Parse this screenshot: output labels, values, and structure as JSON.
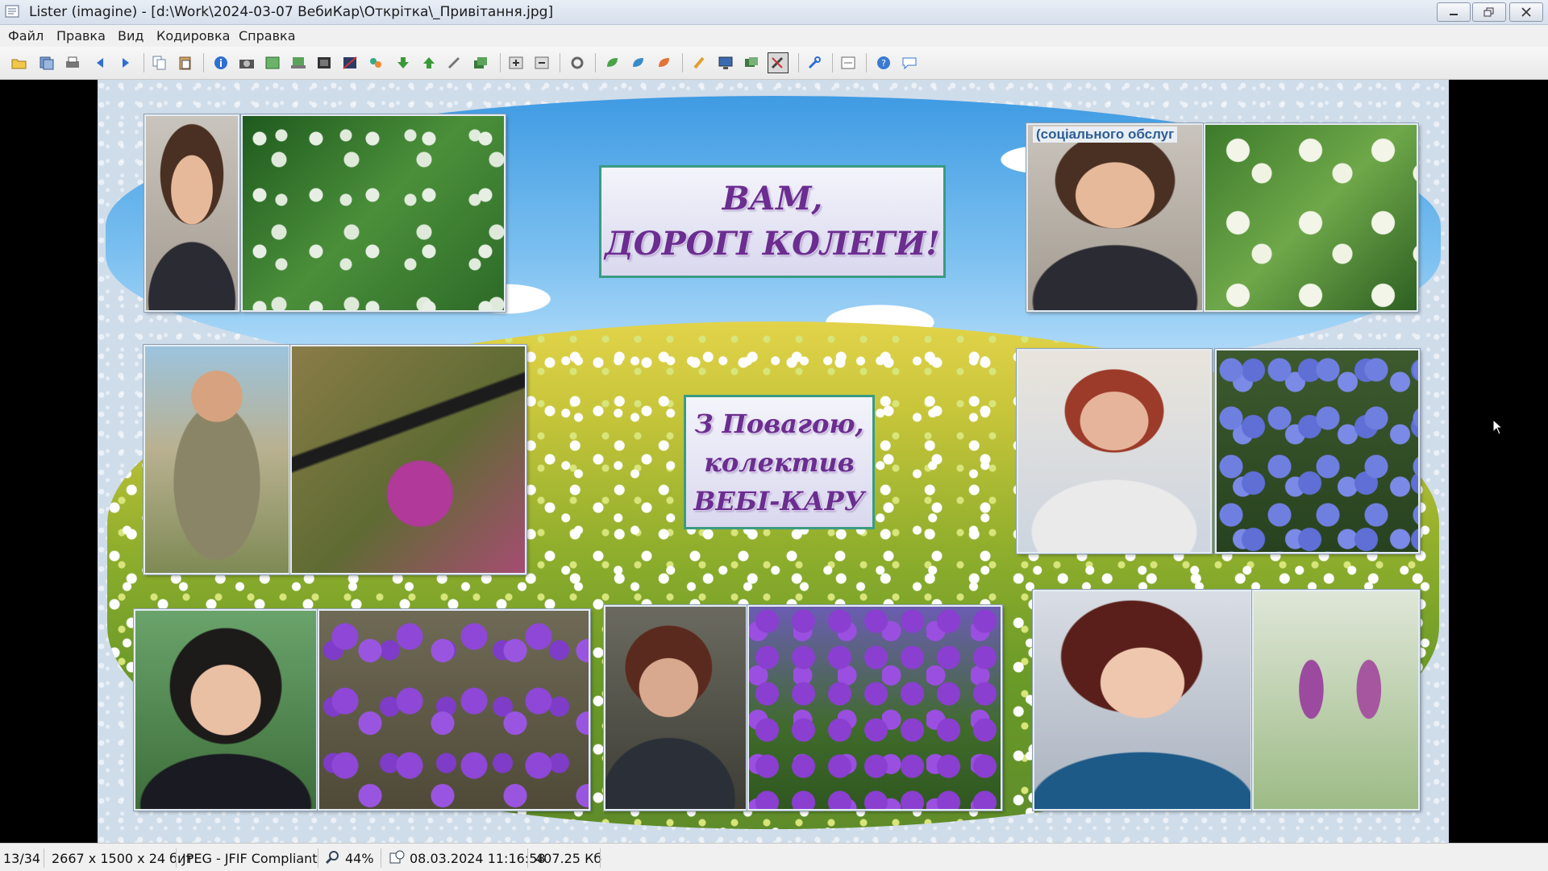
{
  "window": {
    "title": "Lister (imagine) - [d:\\Work\\2024-03-07 ВебиКар\\Открітка\\_Привітання.jpg]"
  },
  "menu": [
    "Файл",
    "Правка",
    "Вид",
    "Кодировка",
    "Справка"
  ],
  "toolbar_icons": [
    "open-icon",
    "save-icon",
    "print-icon",
    "back-icon",
    "forward-icon",
    "copy-icon",
    "paste-icon",
    "info-icon",
    "camera-icon",
    "fit-icon",
    "scan-icon",
    "frame-icon",
    "crop-icon",
    "effects-icon",
    "arrow-down-icon",
    "arrow-up-icon",
    "tool-icon",
    "layers-icon",
    "zoom-in-icon",
    "zoom-out-icon",
    "settings-icon",
    "leaf-icon",
    "leaf2-icon",
    "leaf3-icon",
    "brush-icon",
    "monitor-icon",
    "slideshow-icon",
    "edit-icon",
    "wrench-icon",
    "options-icon",
    "help-icon",
    "comment-icon"
  ],
  "image": {
    "greeting_line1": "ВАМ,",
    "greeting_line2": "ДОРОГІ КОЛЕГИ!",
    "sign_line1": "З Повагою,",
    "sign_line2": "колектив",
    "sign_line3": "ВЕБІ-КАРУ",
    "photo_sign_text": "(соціального обслуг",
    "text_color": "#6b2d8f",
    "box_border_color": "#3b9b82"
  },
  "status": {
    "index": "13/34",
    "dimensions": "2667 x 1500 x 24 бит",
    "format": "JPEG - JFIF Compliant",
    "zoom": "44%",
    "datetime": "08.03.2024 11:16:58",
    "filesize": "407.25 Кб"
  }
}
